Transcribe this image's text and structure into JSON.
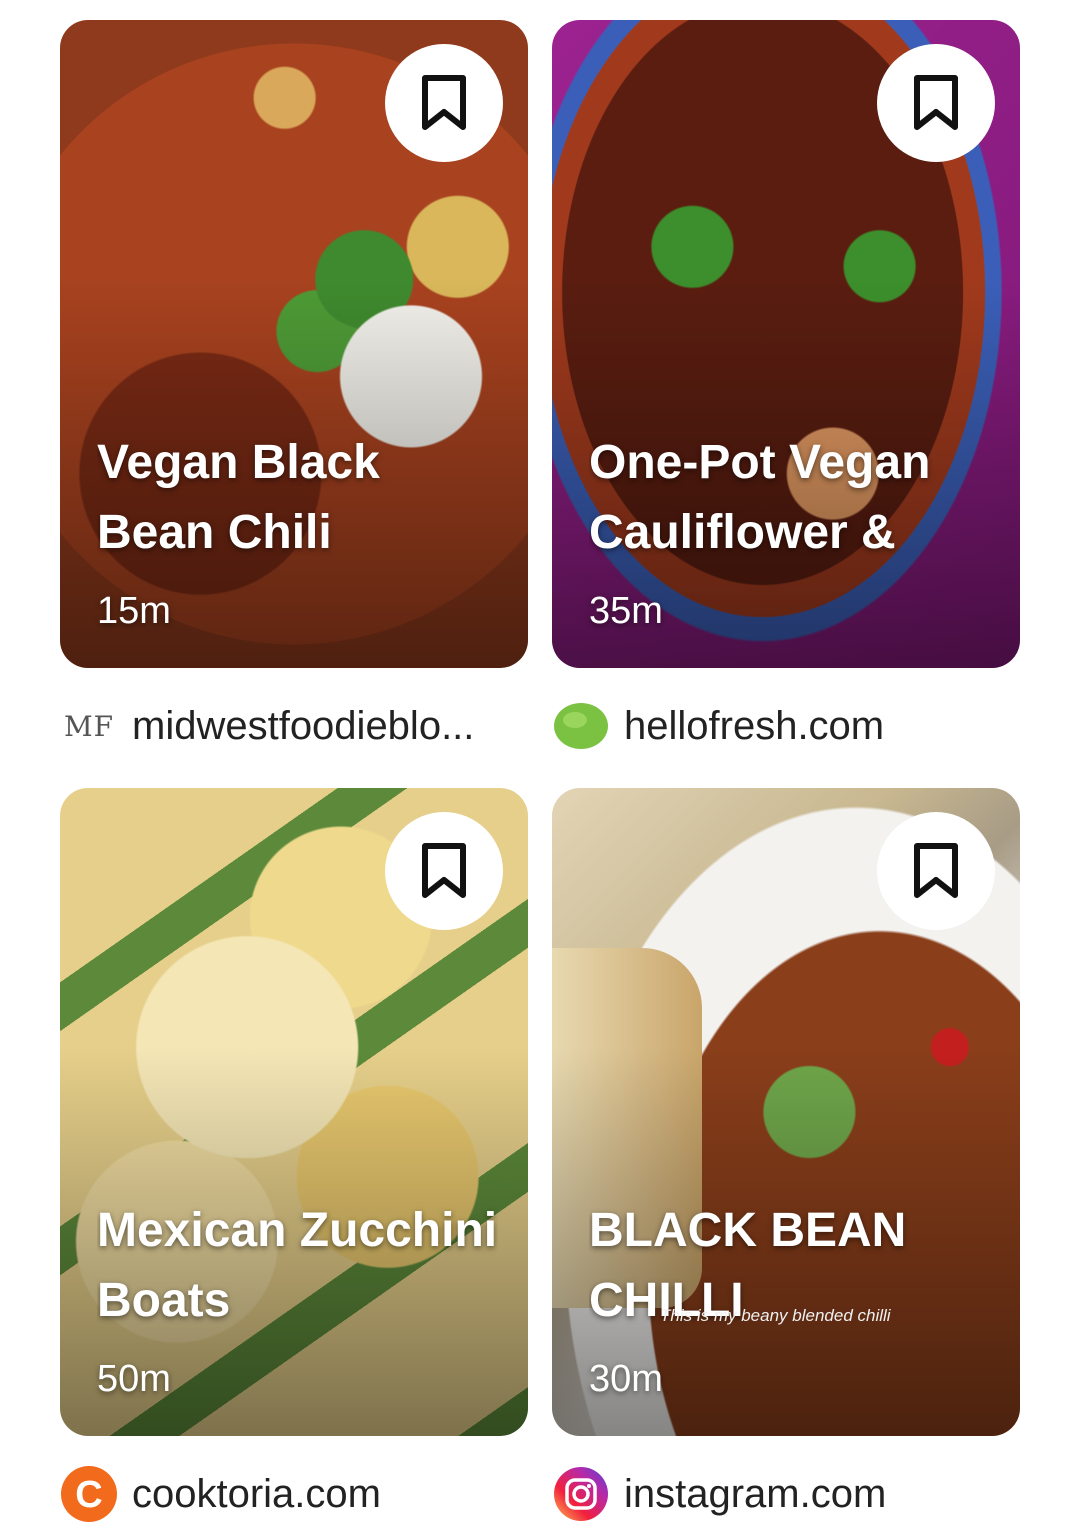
{
  "cards": [
    {
      "title": "Vegan Black Bean Chili",
      "time": "15m",
      "source": "midwestfoodieblo...",
      "source_icon": "mf-logo-icon",
      "source_icon_text": "MF",
      "save_label": "bookmark-icon"
    },
    {
      "title": "One-Pot Vegan Cauliflower &",
      "time": "35m",
      "source": "hellofresh.com",
      "source_icon": "hellofresh-logo-icon",
      "save_label": "bookmark-icon"
    },
    {
      "title": "Mexican Zucchini Boats",
      "time": "50m",
      "source": "cooktoria.com",
      "source_icon": "cooktoria-logo-icon",
      "source_icon_text": "C",
      "save_label": "bookmark-icon"
    },
    {
      "title": "BLACK BEAN CHILLI",
      "time": "30m",
      "source": "instagram.com",
      "source_icon": "instagram-logo-icon",
      "save_label": "bookmark-icon",
      "overlay_caption": "This is my beany blended chilli"
    }
  ],
  "colors": {
    "hellofresh_green": "#7CC242",
    "cooktoria_orange": "#F26A1B",
    "purple_bg": "#8E1C88"
  }
}
